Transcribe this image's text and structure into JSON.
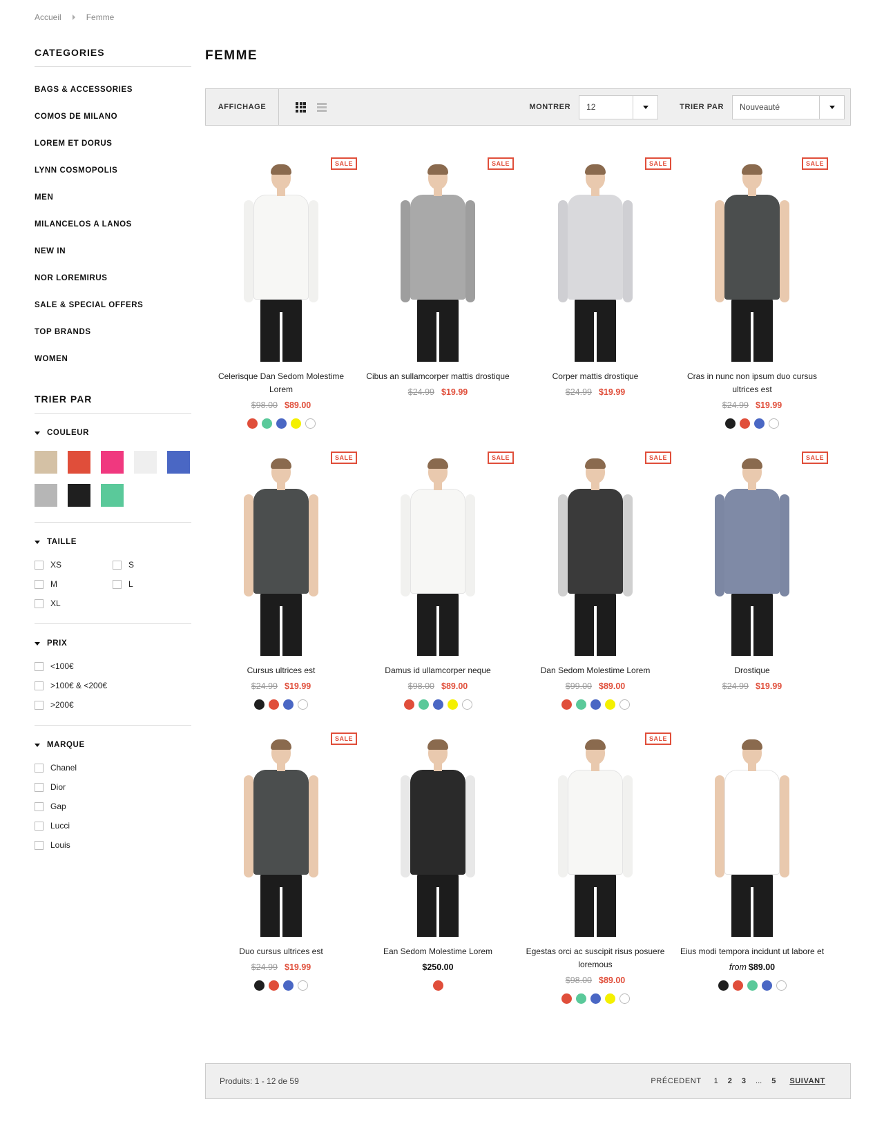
{
  "breadcrumb": {
    "home": "Accueil",
    "current": "Femme"
  },
  "sidebar": {
    "categories_title": "CATEGORIES",
    "categories": [
      "BAGS & ACCESSORIES",
      "COMOS DE MILANO",
      "LOREM ET DORUS",
      "LYNN COSMOPOLIS",
      "MEN",
      "MILANCELOS A LANOS",
      "NEW IN",
      "NOR LOREMIRUS",
      "SALE & SPECIAL OFFERS",
      "TOP BRANDS",
      "WOMEN"
    ],
    "sort_title": "TRIER PAR",
    "color": {
      "title": "COULEUR",
      "swatches": [
        "#d4c1a5",
        "#e04e3a",
        "#f0387f",
        "#efefef",
        "#4a67c4",
        "#b6b6b6",
        "#1f1f1f",
        "#5ac99a"
      ]
    },
    "size": {
      "title": "TAILLE",
      "options": [
        "XS",
        "S",
        "M",
        "L",
        "XL"
      ]
    },
    "price": {
      "title": "PRIX",
      "options": [
        "<100€",
        ">100€ & <200€",
        ">200€"
      ]
    },
    "brand": {
      "title": "MARQUE",
      "options": [
        "Chanel",
        "Dior",
        "Gap",
        "Lucci",
        "Louis"
      ]
    }
  },
  "main": {
    "title": "FEMME",
    "toolbar": {
      "display_label": "AFFICHAGE",
      "show_label": "MONTRER",
      "show_value": "12",
      "sort_label": "TRIER PAR",
      "sort_value": "Nouveauté"
    },
    "products": [
      {
        "name": "Celerisque Dan Sedom Molestime Lorem",
        "old": "$98.00",
        "price": "$89.00",
        "sale": "SALE",
        "top": "#f7f7f5",
        "sleeve": "#f1f1ef",
        "colors": [
          "#e04e3a",
          "#5ac99a",
          "#4a67c4",
          "#f4f000",
          "#ffffff"
        ]
      },
      {
        "name": "Cibus an sullamcorper mattis drostique",
        "old": "$24.99",
        "price": "$19.99",
        "sale": "SALE",
        "top": "#a9a9a9",
        "sleeve": "#9e9e9e",
        "colors": []
      },
      {
        "name": "Corper mattis drostique",
        "old": "$24.99",
        "price": "$19.99",
        "sale": "SALE",
        "top": "#d9d9dc",
        "sleeve": "#cfcfd3",
        "colors": []
      },
      {
        "name": "Cras in nunc non ipsum duo cursus ultrices est",
        "old": "$24.99",
        "price": "$19.99",
        "sale": "SALE",
        "top": "#4b4e4e",
        "sleeve": "#e9c9ae",
        "colors": [
          "#1f1f1f",
          "#e04e3a",
          "#4a67c4",
          "#ffffff"
        ]
      },
      {
        "name": "Cursus ultrices est",
        "old": "$24.99",
        "price": "$19.99",
        "sale": "SALE",
        "top": "#4b4e4e",
        "sleeve": "#e9c9ae",
        "colors": [
          "#1f1f1f",
          "#e04e3a",
          "#4a67c4",
          "#ffffff"
        ]
      },
      {
        "name": "Damus id ullamcorper neque",
        "old": "$98.00",
        "price": "$89.00",
        "sale": "SALE",
        "top": "#f7f7f5",
        "sleeve": "#f1f1ef",
        "colors": [
          "#e04e3a",
          "#5ac99a",
          "#4a67c4",
          "#f4f000",
          "#ffffff"
        ]
      },
      {
        "name": "Dan Sedom Molestime Lorem",
        "old": "$99.00",
        "price": "$89.00",
        "sale": "SALE",
        "top": "#3a3a3a",
        "sleeve": "#d0d0d0",
        "colors": [
          "#e04e3a",
          "#5ac99a",
          "#4a67c4",
          "#f4f000",
          "#ffffff"
        ]
      },
      {
        "name": "Drostique",
        "old": "$24.99",
        "price": "$19.99",
        "sale": "SALE",
        "top": "#7f8aa6",
        "sleeve": "#7c87a3",
        "colors": []
      },
      {
        "name": "Duo cursus ultrices est",
        "old": "$24.99",
        "price": "$19.99",
        "sale": "SALE",
        "top": "#4b4e4e",
        "sleeve": "#e9c9ae",
        "colors": [
          "#1f1f1f",
          "#e04e3a",
          "#4a67c4",
          "#ffffff"
        ]
      },
      {
        "name": "Ean Sedom Molestime Lorem",
        "old": "",
        "price": "",
        "regular": "$250.00",
        "sale": "",
        "top": "#2a2a2a",
        "sleeve": "#e8e8e8",
        "colors": [
          "#e04e3a"
        ]
      },
      {
        "name": "Egestas orci ac suscipit risus posuere loremous",
        "old": "$98.00",
        "price": "$89.00",
        "sale": "SALE",
        "top": "#f7f7f5",
        "sleeve": "#f1f1ef",
        "colors": [
          "#e04e3a",
          "#5ac99a",
          "#4a67c4",
          "#f4f000",
          "#ffffff"
        ]
      },
      {
        "name": "Eius modi tempora incidunt ut labore et",
        "old": "",
        "price": "",
        "from_label": "from",
        "from_price": "$89.00",
        "sale": "",
        "top": "#ffffff",
        "sleeve": "#e9c9ae",
        "colors": [
          "#1f1f1f",
          "#e04e3a",
          "#5ac99a",
          "#4a67c4",
          "#ffffff"
        ]
      }
    ],
    "pager": {
      "count": "Produits: 1 - 12 de 59",
      "prev": "PRÉCEDENT",
      "pages": [
        "1",
        "2",
        "3",
        "...",
        "5"
      ],
      "next": "SUIVANT"
    }
  }
}
